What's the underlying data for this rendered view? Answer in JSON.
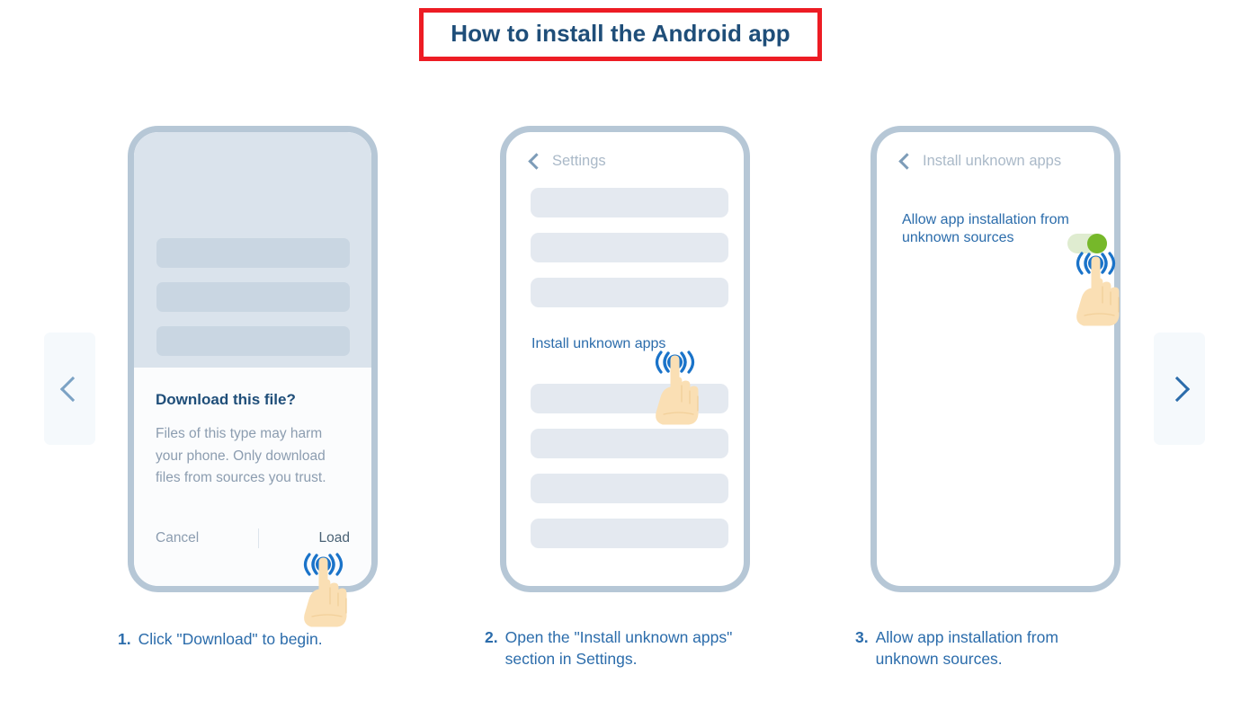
{
  "title": {
    "text": "How to install the Android app",
    "border_color": "#ed1c24",
    "text_color": "#1f4e79"
  },
  "nav": {
    "prev_icon": "chevron-left-icon",
    "next_icon": "chevron-right-icon"
  },
  "steps": [
    {
      "number": "1.",
      "caption": "Click \"Download\" to begin.",
      "phone": {
        "type": "download-dialog",
        "dialog": {
          "title": "Download this file?",
          "body": "Files of this type may harm your phone. Only download files from sources you trust.",
          "cancel_label": "Cancel",
          "confirm_label": "Load"
        },
        "placeholder_rows": 3
      }
    },
    {
      "number": "2.",
      "caption": "Open the \"Install unknown apps\" section in Settings.",
      "phone": {
        "type": "settings-list",
        "header": "Settings",
        "back_icon": "chevron-left-icon",
        "item_label": "Install unknown apps",
        "rows_above": 3,
        "rows_below": 4
      }
    },
    {
      "number": "3.",
      "caption": "Allow app installation from unknown sources.",
      "phone": {
        "type": "permission-toggle",
        "header": "Install unknown apps",
        "back_icon": "chevron-left-icon",
        "setting_label": "Allow app installation from unknown sources",
        "toggle_state": "on",
        "toggle_on_color": "#76b82a",
        "toggle_track_color": "#dfecd0"
      }
    }
  ],
  "tap_indicator": {
    "icon": "tap-hand-icon",
    "ripple_color": "#1a73c9",
    "hand_color": "#fadfb4"
  }
}
